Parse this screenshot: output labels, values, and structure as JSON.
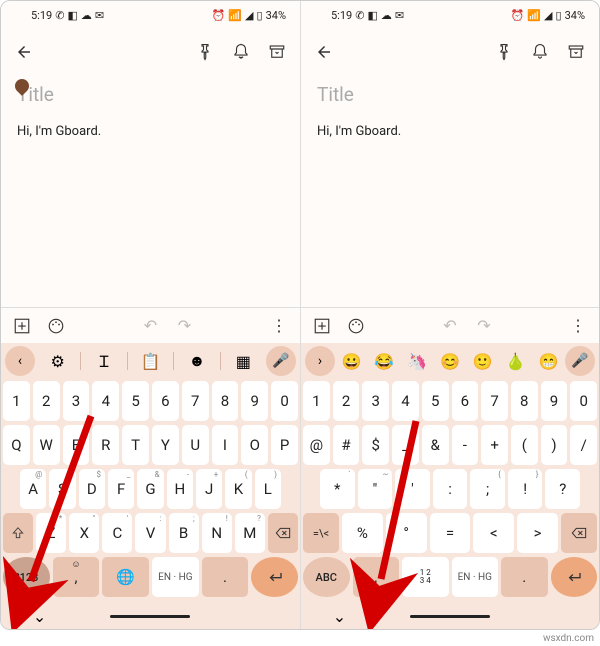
{
  "statusbar": {
    "time": "5:19",
    "battery": "34%"
  },
  "note": {
    "title_placeholder": "Title",
    "body": "Hi, I'm Gboard."
  },
  "left": {
    "suggestions": [
      "⚙",
      "⟷",
      "📄",
      "🖭",
      "🙂"
    ],
    "row_num": [
      "1",
      "2",
      "3",
      "4",
      "5",
      "6",
      "7",
      "8",
      "9",
      "0"
    ],
    "row1": [
      "Q",
      "W",
      "E",
      "R",
      "T",
      "Y",
      "U",
      "I",
      "O",
      "P"
    ],
    "row2": [
      "A",
      "S",
      "D",
      "F",
      "G",
      "H",
      "J",
      "K",
      "L"
    ],
    "row3": [
      "Z",
      "X",
      "C",
      "V",
      "B",
      "N",
      "M"
    ],
    "switch": "?123",
    "space": "EN · HG",
    "comma": ",",
    "emoji_key": "☺",
    "globe": "🌐",
    "dot": "."
  },
  "right": {
    "suggestions": [
      "😀",
      "😂",
      "🦄",
      "😊",
      "🙂",
      "🍐",
      "😁"
    ],
    "row_num": [
      "1",
      "2",
      "3",
      "4",
      "5",
      "6",
      "7",
      "8",
      "9",
      "0"
    ],
    "row1": [
      "@",
      "#",
      "$",
      "_",
      "&",
      "-",
      "+",
      "(",
      ")",
      "/"
    ],
    "row2": [
      "*",
      "\"",
      "'",
      ":",
      ";",
      "!",
      "?"
    ],
    "switch": "ABC",
    "equals": "=\\<",
    "numpad": "1 2\n3 4",
    "space": "EN · HG",
    "comma": ",",
    "dot": "."
  },
  "hints": {
    "row2": [
      "@",
      "#",
      "$",
      "_",
      "&",
      "-",
      "+",
      "(",
      ")"
    ],
    "row3": [
      "*",
      "\"",
      "'",
      ":",
      ";",
      "!",
      "?"
    ],
    "sym2": [
      "`",
      "~",
      "",
      "",
      "{",
      "}"
    ],
    "sym3": [
      "",
      "",
      "",
      "¡",
      "¿"
    ]
  }
}
